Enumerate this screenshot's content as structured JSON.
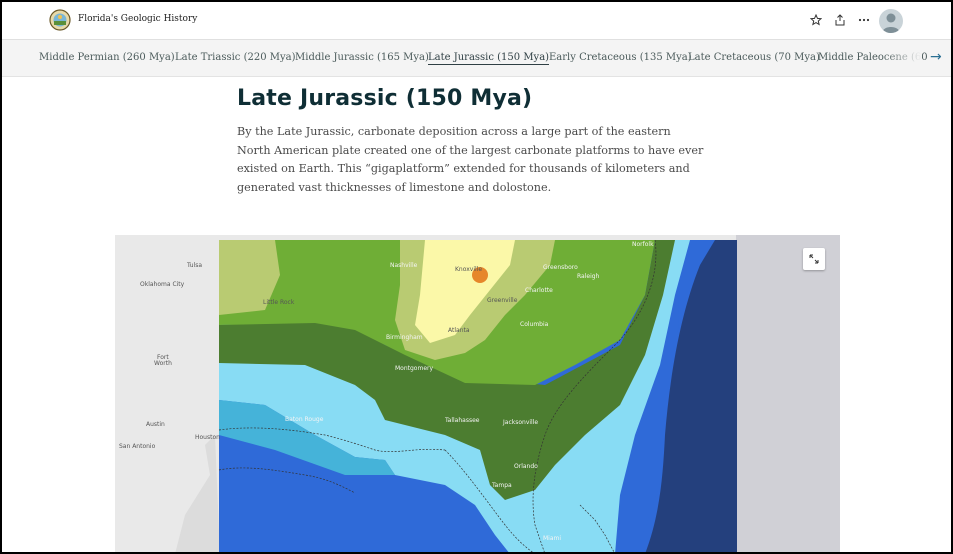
{
  "header": {
    "title": "Florida's Geologic History"
  },
  "nav": {
    "items": [
      {
        "label": "Middle Permian (260 Mya)"
      },
      {
        "label": "Late Triassic (220 Mya)"
      },
      {
        "label": "Middle Jurassic (165 Mya)"
      },
      {
        "label": "Late Jurassic (150 Mya)"
      },
      {
        "label": "Early Cretaceous (135 Mya)"
      },
      {
        "label": "Late Cretaceous (70 Mya)"
      },
      {
        "label": "Middle Paleocene (60"
      }
    ],
    "active_index": 3,
    "next_arrow": "→"
  },
  "content": {
    "heading": "Late Jurassic (150 Mya)",
    "paragraph": "By the Late Jurassic, carbonate deposition across a large part of the eastern North American plate created one of the largest carbonate platforms to have ever existed on Earth.  This “gigaplatform” extended for thousands of kilometers and generated vast thicknesses of limestone and dolostone."
  },
  "map": {
    "labels": {
      "tulsa": "Tulsa",
      "oklahoma_city": "Oklahoma City",
      "little_rock": "Little Rock",
      "fort_worth_1": "Fort",
      "fort_worth_2": "Worth",
      "austin": "Austin",
      "san_antonio": "San Antonio",
      "houston": "Houston",
      "nashville": "Nashville",
      "knoxville": "Knoxville",
      "greensboro": "Greensboro",
      "raleigh": "Raleigh",
      "charlotte": "Charlotte",
      "greenville": "Greenville",
      "columbia": "Columbia",
      "atlanta": "Atlanta",
      "birmingham": "Birmingham",
      "montgomery": "Montgomery",
      "baton_rouge": "Baton Rouge",
      "tallahassee": "Tallahassee",
      "jacksonville": "Jacksonville",
      "orlando": "Orlando",
      "tampa": "Tampa",
      "miami": "Miami",
      "norfolk": "Norfolk"
    },
    "colors": {
      "basemap": "#e8e8e8",
      "deep_ocean": "#24407d",
      "ocean": "#2f6ad8",
      "shallow_water": "#88dcf4",
      "platform": "#4c7d30",
      "lowland": "#6fae36",
      "upland": "#b9cb72",
      "highland": "#fbf8a8",
      "peak": "#e6872a"
    }
  }
}
